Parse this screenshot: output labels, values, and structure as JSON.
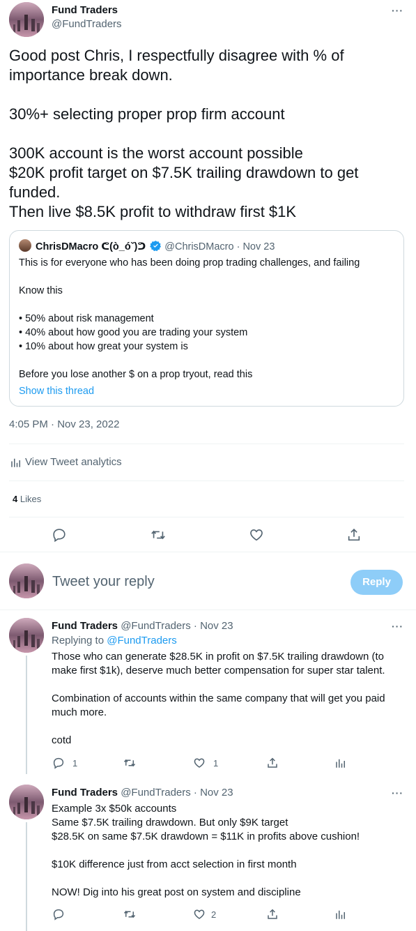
{
  "main_tweet": {
    "author_name": "Fund Traders",
    "author_handle": "@FundTraders",
    "text_p1": "Good post Chris, I respectfully disagree with % of importance break down.",
    "text_p2": "30%+ selecting proper prop firm account",
    "text_p3": "300K account is the worst account possible\n$20K profit target on $7.5K trailing drawdown to get funded.\nThen live $8.5K profit to withdraw first $1K",
    "timestamp": "4:05 PM · Nov 23, 2022",
    "analytics_label": "View Tweet analytics",
    "likes_count": "4",
    "likes_label": "Likes"
  },
  "quoted_tweet": {
    "author_name": "ChrisDMacro ᕦ(ò_óˇ)ᕤ",
    "author_handle": "@ChrisDMacro",
    "date": "· Nov 23",
    "text_p1": "This is for everyone who has been doing prop trading challenges, and failing",
    "text_p2": "Know this",
    "bullets": [
      "• 50% about risk management",
      "• 40% about how good you are trading your system",
      "• 10% about how great your system is"
    ],
    "text_p3": "Before you lose another $ on a prop tryout, read this",
    "show_thread": "Show this thread"
  },
  "composer": {
    "placeholder": "Tweet your reply",
    "reply_button": "Reply"
  },
  "replies": [
    {
      "author_name": "Fund Traders",
      "author_handle": "@FundTraders",
      "date": "· Nov 23",
      "replying_prefix": "Replying to ",
      "replying_handle": "@FundTraders",
      "text": "Those who can generate $28.5K in profit on $7.5K trailing drawdown (to make first $1k), deserve much better compensation for super star talent.\n\nCombination of accounts within the same company that will get you paid much more.\n\ncotd",
      "reply_count": "1",
      "like_count": "1"
    },
    {
      "author_name": "Fund Traders",
      "author_handle": "@FundTraders",
      "date": "· Nov 23",
      "text": "Example 3x $50k accounts\nSame $7.5K trailing drawdown. But only $9K target\n$28.5K on same $7.5K drawdown = $11K in profits above cushion!\n\n$10K difference just from acct selection in first month\n\nNOW! Dig into his great post on system and discipline",
      "like_count": "2"
    }
  ],
  "colors": {
    "accent": "#1d9bf0",
    "reply_button_bg": "#8ecdf8",
    "secondary_text": "#536471",
    "border": "#cfd9de"
  }
}
